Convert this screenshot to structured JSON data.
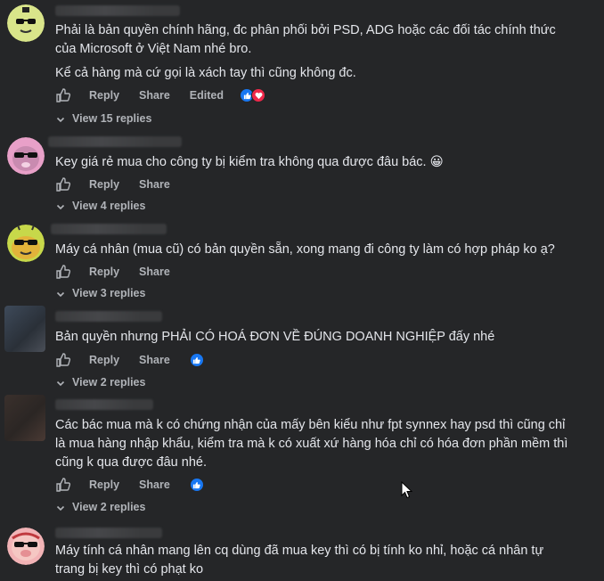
{
  "comments": [
    {
      "lines": [
        "Phải là bản quyền chính hãng, đc phân phối bởi PSD, ADG hoặc các đối tác chính thức",
        "của Microsoft ở Việt Nam nhé bro.",
        "Kể cả hàng mà cứ gọi là xách tay thì cũng không đc."
      ],
      "reply": "Reply",
      "share": "Share",
      "edited": "Edited",
      "replies": "View 15 replies",
      "reactions": [
        "like",
        "love"
      ]
    },
    {
      "lines": [
        "Key giá rẻ mua cho công ty bị kiểm tra không qua được đâu bác. 😀"
      ],
      "reply": "Reply",
      "share": "Share",
      "replies": "View 4 replies"
    },
    {
      "lines": [
        "Máy cá nhân (mua cũ) có bản quyền sẵn, xong mang đi công ty làm có hợp pháp ko ạ?"
      ],
      "reply": "Reply",
      "share": "Share",
      "replies": "View 3 replies"
    },
    {
      "lines": [
        "Bản quyền nhưng PHẢI CÓ HOÁ ĐƠN VỀ ĐÚNG DOANH NGHIỆP đấy nhé"
      ],
      "reply": "Reply",
      "share": "Share",
      "replies": "View 2 replies",
      "reactions": [
        "like"
      ]
    },
    {
      "lines": [
        "Các bác mua mà k có chứng nhận của mấy bên kiểu như fpt synnex hay psd thì cũng chỉ",
        "là mua hàng nhập khẩu, kiểm tra mà k có xuất xứ hàng hóa chỉ có hóa đơn phần mềm thì",
        "cũng k qua được đâu nhé."
      ],
      "reply": "Reply",
      "share": "Share",
      "replies": "View 2 replies",
      "reactions": [
        "like"
      ]
    },
    {
      "lines": [
        "Máy tính cá nhân mang lên cq dùng đã mua key thì có bị tính ko nhỉ, hoặc cá nhân tự",
        "trang bị key thì có phạt ko"
      ]
    }
  ],
  "colors": {
    "background": "#252628",
    "text": "#e4e6eb",
    "secondary": "#b0b3b8",
    "like": "#1877f2",
    "love": "#f0284a"
  }
}
